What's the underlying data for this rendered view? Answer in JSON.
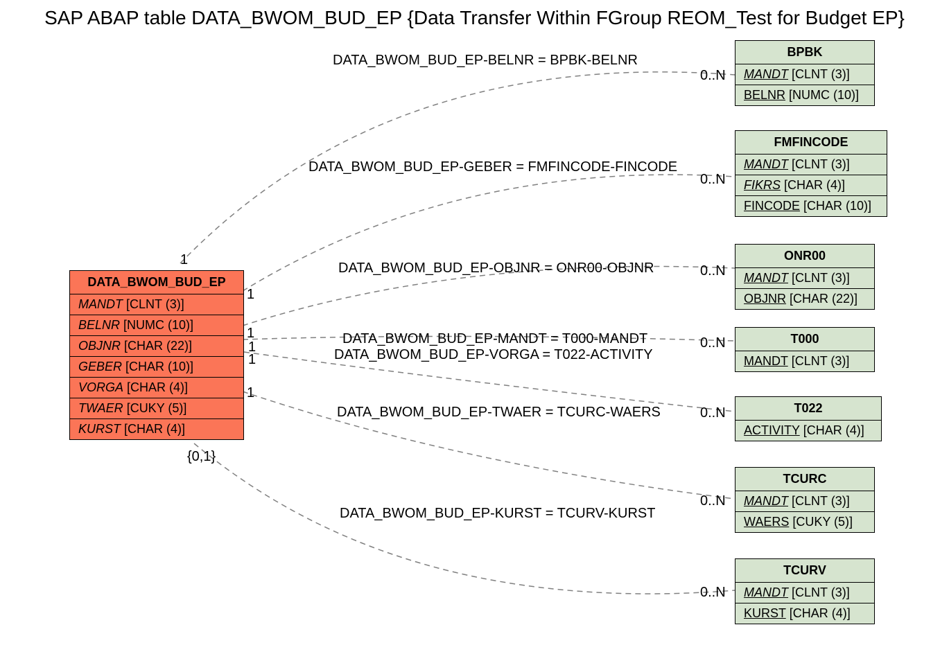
{
  "title": "SAP ABAP table DATA_BWOM_BUD_EP {Data Transfer Within FGroup REOM_Test for Budget EP}",
  "main": {
    "name": "DATA_BWOM_BUD_EP",
    "fields": [
      {
        "name": "MANDT",
        "type": "[CLNT (3)]"
      },
      {
        "name": "BELNR",
        "type": "[NUMC (10)]"
      },
      {
        "name": "OBJNR",
        "type": "[CHAR (22)]"
      },
      {
        "name": "GEBER",
        "type": "[CHAR (10)]"
      },
      {
        "name": "VORGA",
        "type": "[CHAR (4)]"
      },
      {
        "name": "TWAER",
        "type": "[CUKY (5)]"
      },
      {
        "name": "KURST",
        "type": "[CHAR (4)]"
      }
    ],
    "card_top": "1",
    "card_r1": "1",
    "card_r2": "1",
    "card_r3": "1",
    "card_r4": "1",
    "card_r5": "1",
    "card_bottom": "{0,1}"
  },
  "targets": [
    {
      "name": "BPBK",
      "fields": [
        {
          "n": "MANDT",
          "t": "[CLNT (3)]",
          "s": "iu"
        },
        {
          "n": "BELNR",
          "t": "[NUMC (10)]",
          "s": "u"
        }
      ],
      "card": "0..N"
    },
    {
      "name": "FMFINCODE",
      "fields": [
        {
          "n": "MANDT",
          "t": "[CLNT (3)]",
          "s": "iu"
        },
        {
          "n": "FIKRS",
          "t": "[CHAR (4)]",
          "s": "iu"
        },
        {
          "n": "FINCODE",
          "t": "[CHAR (10)]",
          "s": "u"
        }
      ],
      "card": "0..N"
    },
    {
      "name": "ONR00",
      "fields": [
        {
          "n": "MANDT",
          "t": "[CLNT (3)]",
          "s": "iu"
        },
        {
          "n": "OBJNR",
          "t": "[CHAR (22)]",
          "s": "u"
        }
      ],
      "card": "0..N"
    },
    {
      "name": "T000",
      "fields": [
        {
          "n": "MANDT",
          "t": "[CLNT (3)]",
          "s": "u"
        }
      ],
      "card": "0..N"
    },
    {
      "name": "T022",
      "fields": [
        {
          "n": "ACTIVITY",
          "t": "[CHAR (4)]",
          "s": "u"
        }
      ],
      "card": "0..N"
    },
    {
      "name": "TCURC",
      "fields": [
        {
          "n": "MANDT",
          "t": "[CLNT (3)]",
          "s": "iu"
        },
        {
          "n": "WAERS",
          "t": "[CUKY (5)]",
          "s": "u"
        }
      ],
      "card": "0..N"
    },
    {
      "name": "TCURV",
      "fields": [
        {
          "n": "MANDT",
          "t": "[CLNT (3)]",
          "s": "iu"
        },
        {
          "n": "KURST",
          "t": "[CHAR (4)]",
          "s": "u"
        }
      ],
      "card": "0..N"
    }
  ],
  "joins": [
    "DATA_BWOM_BUD_EP-BELNR = BPBK-BELNR",
    "DATA_BWOM_BUD_EP-GEBER = FMFINCODE-FINCODE",
    "DATA_BWOM_BUD_EP-OBJNR = ONR00-OBJNR",
    "DATA_BWOM_BUD_EP-MANDT = T000-MANDT",
    "DATA_BWOM_BUD_EP-VORGA = T022-ACTIVITY",
    "DATA_BWOM_BUD_EP-TWAER = TCURC-WAERS",
    "DATA_BWOM_BUD_EP-KURST = TCURV-KURST"
  ]
}
